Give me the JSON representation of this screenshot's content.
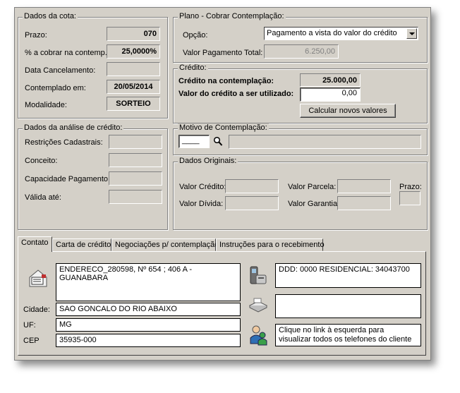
{
  "dados_cota": {
    "legend": "Dados da cota:",
    "prazo_label": "Prazo:",
    "prazo_value": "070",
    "cobrar_label": "% a cobrar na contemp.",
    "cobrar_value": "25,0000%",
    "cancel_label": "Data Cancelamento:",
    "cancel_value": "",
    "contemplado_label": "Contemplado em:",
    "contemplado_value": "20/05/2014",
    "modalidade_label": "Modalidade:",
    "modalidade_value": "SORTEIO"
  },
  "plano": {
    "legend": "Plano - Cobrar Contemplação:",
    "opcao_label": "Opção:",
    "opcao_value": "Pagamento a vista do valor do crédito",
    "valor_total_label": "Valor Pagamento Total:",
    "valor_total_value": "6.250,00"
  },
  "credito": {
    "legend": "Crédito:",
    "contemplacao_label": "Crédito na contemplação:",
    "contemplacao_value": "25.000,00",
    "utilizado_label": "Valor do crédito a ser utilizado:",
    "utilizado_value": "0,00",
    "calc_button": "Calcular novos valores"
  },
  "analise": {
    "legend": "Dados da análise de crédito:",
    "restricoes_label": "Restrições Cadastrais:",
    "conceito_label": "Conceito:",
    "capacidade_label": "Capacidade Pagamento:",
    "valida_label": "Válida até:"
  },
  "motivo": {
    "legend": "Motivo de Contemplação:",
    "code_value": "____"
  },
  "originais": {
    "legend": "Dados Originais:",
    "valor_credito_label": "Valor Crédito:",
    "valor_parcela_label": "Valor Parcela:",
    "prazo_label": "Prazo:",
    "valor_divida_label": "Valor Dívida:",
    "valor_garantia_label": "Valor Garantia:"
  },
  "tabs": [
    "Contato",
    "Carta de crédito",
    "Negociações p/ contemplação",
    "Instruções para o recebimento"
  ],
  "contato": {
    "endereco_value": "ENDERECO_280598, Nº 654 ; 406 A - GUANABARA",
    "cidade_label": "Cidade:",
    "cidade_value": "SAO GONCALO DO RIO ABAIXO",
    "uf_label": "UF:",
    "uf_value": "MG",
    "cep_label": "CEP",
    "cep_value": "35935-000",
    "telefone_value": "DDD: 0000  RESIDENCIAL: 34043700",
    "fax_value": "",
    "hint_value": "Clique no link à esquerda para visualizar todos os telefones do cliente"
  }
}
